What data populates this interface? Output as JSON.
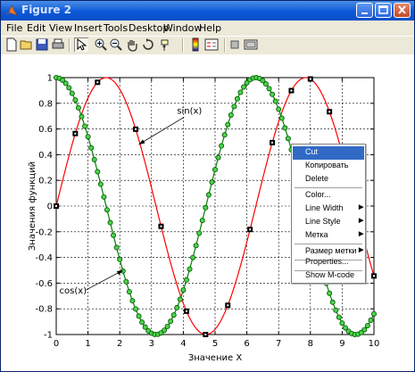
{
  "window": {
    "title": "Figure 2",
    "title_color": "#d8e4ff",
    "titlebar_color": "#0b58d8"
  },
  "menubar": {
    "items": [
      "File",
      "Edit",
      "View",
      "Insert",
      "Tools",
      "Desktop",
      "Window",
      "Help"
    ]
  },
  "toolbar": {
    "icons": [
      "new-figure-icon",
      "open-file-icon",
      "save-icon",
      "print-icon",
      "edit-plot-arrow-icon",
      "zoom-in-icon",
      "zoom-out-icon",
      "pan-hand-icon",
      "rotate-3d-icon",
      "data-cursor-icon",
      "insert-colorbar-icon",
      "insert-legend-icon",
      "hide-plot-tools-icon",
      "show-plot-tools-icon"
    ],
    "pressed": "edit-plot-arrow-icon"
  },
  "chart_data": {
    "type": "line",
    "xlabel": "Значение X",
    "ylabel": "Значения функций",
    "xlim": [
      0,
      10
    ],
    "ylim": [
      -1,
      1
    ],
    "xticks": [
      "0",
      "1",
      "2",
      "3",
      "4",
      "5",
      "6",
      "7",
      "8",
      "9",
      "10"
    ],
    "yticks": [
      "1",
      "0.8",
      "0.6",
      "0.4",
      "0.2",
      "0",
      "-0.2",
      "-0.4",
      "-0.6",
      "-0.8",
      "-1"
    ],
    "grid": true,
    "series": [
      {
        "function": "sin",
        "color": "#ff0000",
        "marker": "black-square",
        "marker_x": [
          0,
          0.6,
          1.3,
          2.5,
          3.3,
          4.1,
          4.7,
          5.4,
          6.1,
          6.8,
          7.4,
          8.0,
          8.6,
          9.4,
          10.0
        ]
      },
      {
        "function": "cos",
        "color": "#008000",
        "marker": "green-circle"
      }
    ],
    "annotations": [
      {
        "text": "sin(x)",
        "label_x": 3.8,
        "label_y": 0.72,
        "target_x": 2.6,
        "target_y": 0.48
      },
      {
        "text": "cos(x)",
        "label_x": 0.1,
        "label_y": -0.68,
        "target_x": 2.1,
        "target_y": -0.5
      }
    ]
  },
  "context_menu": {
    "items": [
      {
        "label": "Cut",
        "highlighted": true,
        "submenu": false
      },
      {
        "label": "Копировать",
        "highlighted": false,
        "submenu": false
      },
      {
        "label": "Delete",
        "highlighted": false,
        "submenu": false
      },
      {
        "label": "Color...",
        "highlighted": false,
        "submenu": false,
        "separator_before": true
      },
      {
        "label": "Line Width",
        "highlighted": false,
        "submenu": true
      },
      {
        "label": "Line Style",
        "highlighted": false,
        "submenu": true
      },
      {
        "label": "Метка",
        "highlighted": false,
        "submenu": true
      },
      {
        "label": "Размер метки",
        "highlighted": false,
        "submenu": true,
        "separator_before": true
      },
      {
        "label": "Properties...",
        "highlighted": false,
        "submenu": false,
        "separator_before": true
      },
      {
        "label": "Show M-code",
        "highlighted": false,
        "submenu": false,
        "separator_before": true
      }
    ]
  }
}
